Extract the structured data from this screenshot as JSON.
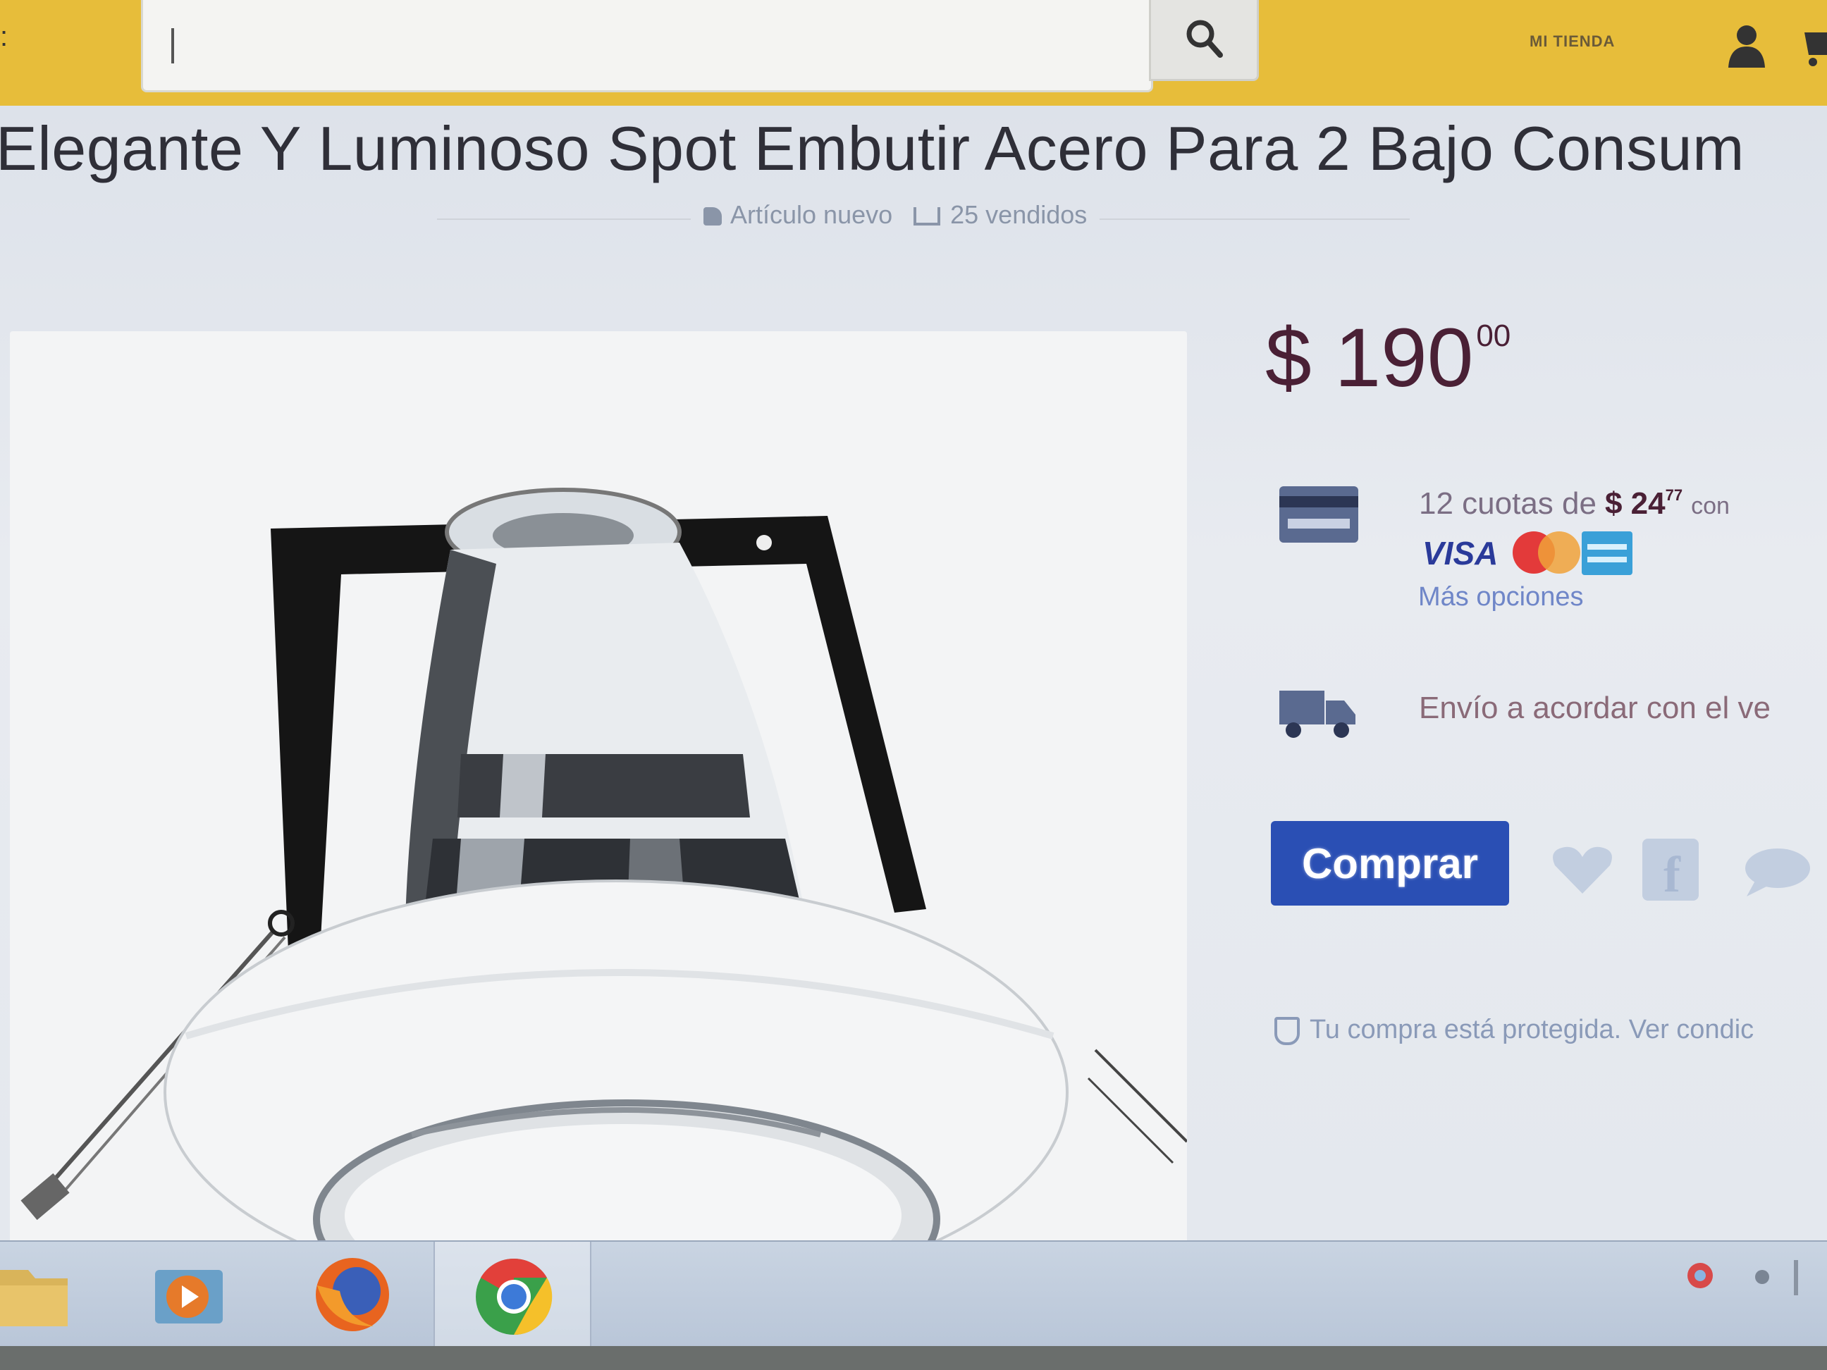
{
  "header": {
    "search": {
      "value": "",
      "placeholder": ""
    },
    "account_label": "MI TIENDA",
    "icons": [
      "search-icon",
      "user-icon",
      "cart-icon"
    ]
  },
  "product": {
    "title": "Elegante Y Luminoso Spot Embutir Acero Para 2 Bajo Consum",
    "condition": "Artículo nuevo",
    "sold": "25 vendidos",
    "price": {
      "currency": "$",
      "amount": "190",
      "cents": "00"
    },
    "installments": {
      "text": "12 cuotas de",
      "amount": "$ 24",
      "cents": "77",
      "suffix": "con"
    },
    "payment_cards": [
      "VISA",
      "MasterCard",
      "American Express"
    ],
    "more_options": "Más opciones",
    "shipping": "Envío a acordar con el ve",
    "buy_label": "Comprar",
    "protected": "Tu compra está protegida. Ver condic"
  },
  "taskbar": {
    "items": [
      "folder-icon",
      "media-player-icon",
      "firefox-icon",
      "chrome-icon"
    ]
  },
  "colors": {
    "header_bg": "#e7bd3a",
    "buy_button": "#2a4fb4",
    "price": "#4a2035",
    "link": "#6f86c8"
  }
}
